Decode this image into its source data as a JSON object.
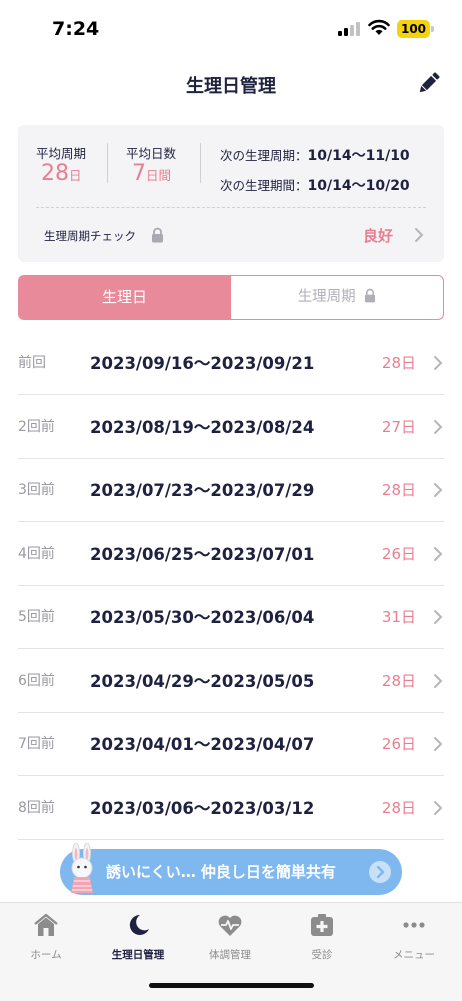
{
  "status": {
    "time": "7:24",
    "battery": "100"
  },
  "header": {
    "title": "生理日管理"
  },
  "summary": {
    "avg_cycle_label": "平均周期",
    "avg_cycle_value": "28",
    "avg_cycle_unit": "日",
    "avg_days_label": "平均日数",
    "avg_days_value": "7",
    "avg_days_unit": "日間",
    "next_cycle_label": "次の生理周期：",
    "next_cycle_value": "10/14〜11/10",
    "next_period_label": "次の生理期間：",
    "next_period_value": "10/14〜10/20",
    "check_label": "生理周期チェック",
    "check_value": "良好"
  },
  "tabs": {
    "active": "生理日",
    "inactive": "生理周期"
  },
  "history": [
    {
      "label": "前回",
      "range": "2023/09/16〜2023/09/21",
      "days": "28日"
    },
    {
      "label": "2回前",
      "range": "2023/08/19〜2023/08/24",
      "days": "27日"
    },
    {
      "label": "3回前",
      "range": "2023/07/23〜2023/07/29",
      "days": "28日"
    },
    {
      "label": "4回前",
      "range": "2023/06/25〜2023/07/01",
      "days": "26日"
    },
    {
      "label": "5回前",
      "range": "2023/05/30〜2023/06/04",
      "days": "31日"
    },
    {
      "label": "6回前",
      "range": "2023/04/29〜2023/05/05",
      "days": "28日"
    },
    {
      "label": "7回前",
      "range": "2023/04/01〜2023/04/07",
      "days": "26日"
    },
    {
      "label": "8回前",
      "range": "2023/03/06〜2023/03/12",
      "days": "28日"
    }
  ],
  "banner": {
    "text": "誘いにくい… 仲良し日を簡単共有"
  },
  "tabbar": [
    {
      "label": "ホーム",
      "icon": "home-icon"
    },
    {
      "label": "生理日管理",
      "icon": "moon-icon"
    },
    {
      "label": "体調管理",
      "icon": "heart-pulse-icon"
    },
    {
      "label": "受診",
      "icon": "medical-cross-icon"
    },
    {
      "label": "メニュー",
      "icon": "more-dots-icon"
    }
  ],
  "colors": {
    "accent": "#e77f92",
    "tab_active": "#e88a99",
    "navy": "#1f2140",
    "banner": "#7fb8ef"
  }
}
